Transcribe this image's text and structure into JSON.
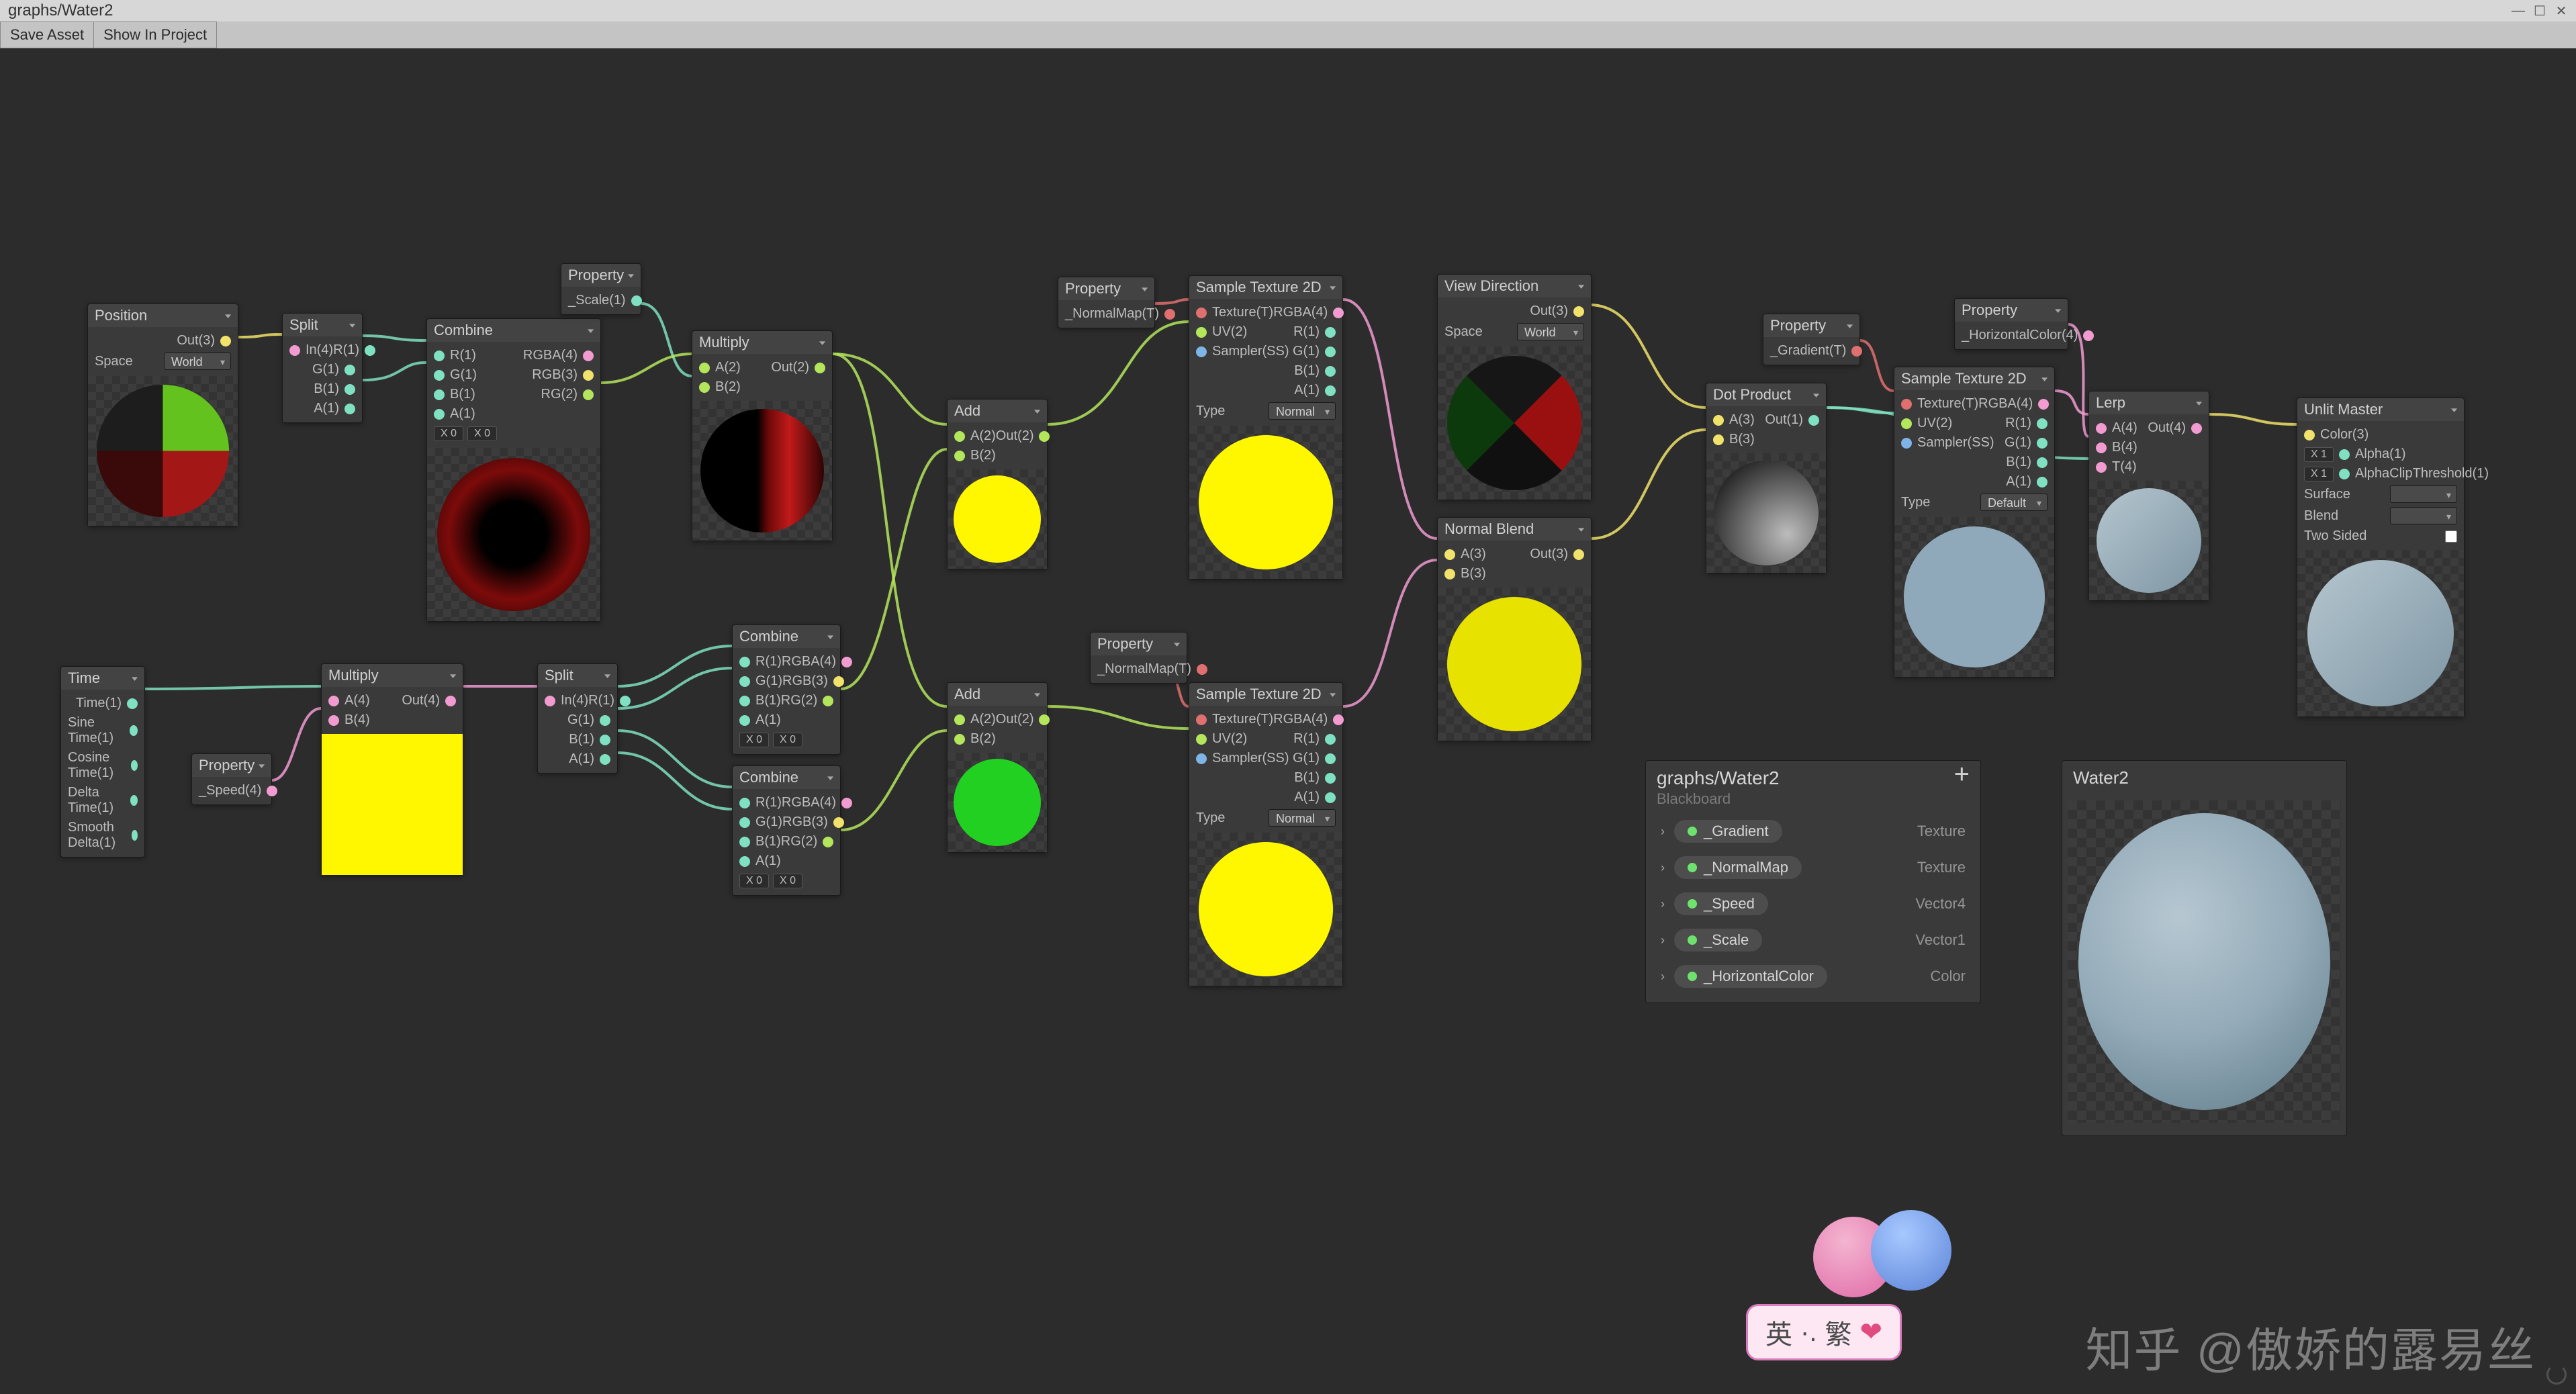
{
  "window": {
    "title": "graphs/Water2",
    "min": "—",
    "max": "☐",
    "close": "✕"
  },
  "toolbar": {
    "save": "Save Asset",
    "show": "Show In Project"
  },
  "nodes": {
    "position": {
      "title": "Position",
      "out": "Out(3)",
      "space_label": "Space",
      "space_value": "World"
    },
    "split1": {
      "title": "Split",
      "in": "In(4)",
      "r": "R(1)",
      "g": "G(1)",
      "b": "B(1)",
      "a": "A(1)"
    },
    "combine1": {
      "title": "Combine",
      "r": "R(1)",
      "g": "G(1)",
      "b": "B(1)",
      "a": "A(1)",
      "rgba": "RGBA(4)",
      "rgb": "RGB(3)",
      "rg": "RG(2)"
    },
    "prop_scale": {
      "title": "Property",
      "label": "_Scale(1)"
    },
    "multiply1": {
      "title": "Multiply",
      "a": "A(2)",
      "b": "B(2)",
      "out": "Out(2)"
    },
    "time": {
      "title": "Time",
      "t": "Time(1)",
      "sin": "Sine Time(1)",
      "cos": "Cosine Time(1)",
      "delta": "Delta Time(1)",
      "smooth": "Smooth Delta(1)"
    },
    "prop_speed": {
      "title": "Property",
      "label": "_Speed(4)"
    },
    "multiply2": {
      "title": "Multiply",
      "a": "A(4)",
      "b": "B(4)",
      "out": "Out(4)"
    },
    "split2": {
      "title": "Split",
      "in": "In(4)",
      "r": "R(1)",
      "g": "G(1)",
      "b": "B(1)",
      "a": "A(1)"
    },
    "combine2": {
      "title": "Combine",
      "r": "R(1)",
      "g": "G(1)",
      "b": "B(1)",
      "a": "A(1)",
      "rgba": "RGBA(4)",
      "rgb": "RGB(3)",
      "rg": "RG(2)",
      "xv": "X 0",
      "xv2": "X 0"
    },
    "combine3": {
      "title": "Combine",
      "r": "R(1)",
      "g": "G(1)",
      "b": "B(1)",
      "a": "A(1)",
      "rgba": "RGBA(4)",
      "rgb": "RGB(3)",
      "rg": "RG(2)",
      "xv": "X 0",
      "xv2": "X 0"
    },
    "prop_norm1": {
      "title": "Property",
      "label": "_NormalMap(T)"
    },
    "prop_norm2": {
      "title": "Property",
      "label": "_NormalMap(T)"
    },
    "add1": {
      "title": "Add",
      "a": "A(2)",
      "b": "B(2)",
      "out": "Out(2)"
    },
    "add2": {
      "title": "Add",
      "a": "A(2)",
      "b": "B(2)",
      "out": "Out(2)"
    },
    "sample1": {
      "title": "Sample Texture 2D",
      "tex": "Texture(T)",
      "uv": "UV(2)",
      "samp": "Sampler(SS)",
      "rgba": "RGBA(4)",
      "r": "R(1)",
      "g": "G(1)",
      "b": "B(1)",
      "a": "A(1)",
      "type_l": "Type",
      "type_v": "Normal"
    },
    "sample2": {
      "title": "Sample Texture 2D",
      "tex": "Texture(T)",
      "uv": "UV(2)",
      "samp": "Sampler(SS)",
      "rgba": "RGBA(4)",
      "r": "R(1)",
      "g": "G(1)",
      "b": "B(1)",
      "a": "A(1)",
      "type_l": "Type",
      "type_v": "Normal"
    },
    "viewdir": {
      "title": "View Direction",
      "out": "Out(3)",
      "space_label": "Space",
      "space_value": "World"
    },
    "normalblend": {
      "title": "Normal Blend",
      "a": "A(3)",
      "b": "B(3)",
      "out": "Out(3)"
    },
    "dot": {
      "title": "Dot Product",
      "a": "A(3)",
      "b": "B(3)",
      "out": "Out(1)"
    },
    "prop_grad": {
      "title": "Property",
      "label": "_Gradient(T)"
    },
    "sample3": {
      "title": "Sample Texture 2D",
      "tex": "Texture(T)",
      "uv": "UV(2)",
      "samp": "Sampler(SS)",
      "rgba": "RGBA(4)",
      "r": "R(1)",
      "g": "G(1)",
      "b": "B(1)",
      "a": "A(1)",
      "type_l": "Type",
      "type_v": "Default"
    },
    "prop_hc": {
      "title": "Property",
      "label": "_HorizontalColor(4)"
    },
    "lerp": {
      "title": "Lerp",
      "a": "A(4)",
      "b": "B(4)",
      "t": "T(4)",
      "out": "Out(4)"
    },
    "master": {
      "title": "Unlit Master",
      "color": "Color(3)",
      "alpha": "Alpha(1)",
      "clip": "AlphaClipThreshold(1)",
      "surface_l": "Surface",
      "blend_l": "Blend",
      "two_l": "Two Sided",
      "x1": "X 1",
      "x1b": "X 1"
    }
  },
  "blackboard": {
    "title": "graphs/Water2",
    "subtitle": "Blackboard",
    "add": "+",
    "items": [
      {
        "name": "_Gradient",
        "type": "Texture"
      },
      {
        "name": "_NormalMap",
        "type": "Texture"
      },
      {
        "name": "_Speed",
        "type": "Vector4"
      },
      {
        "name": "_Scale",
        "type": "Vector1"
      },
      {
        "name": "_HorizontalColor",
        "type": "Color"
      }
    ]
  },
  "main_preview": {
    "title": "Water2"
  },
  "watermark": {
    "text": "知乎 @傲娇的露易丝",
    "badge_a": "英",
    "badge_dot": "·.",
    "badge_b": "繁",
    "badge_heart": "❤"
  }
}
